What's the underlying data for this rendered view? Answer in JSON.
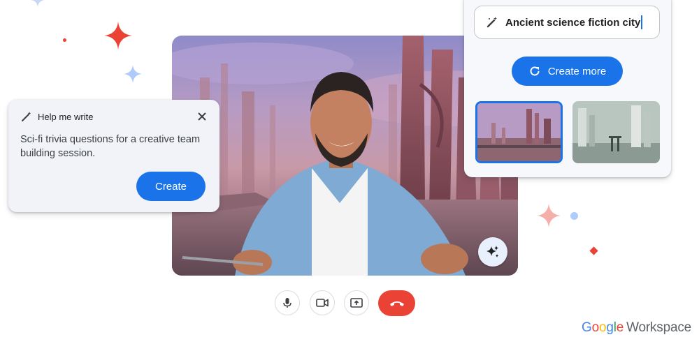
{
  "help_me_write": {
    "title": "Help me write",
    "prompt": "Sci-fi trivia questions for a creative team building session.",
    "create_label": "Create",
    "icons": {
      "title": "magic-pen-icon",
      "close": "close-icon"
    }
  },
  "background_panel": {
    "prompt_value": "Ancient science fiction city",
    "create_more_label": "Create more",
    "thumbnails": [
      {
        "name": "generated-background-1",
        "selected": true
      },
      {
        "name": "generated-background-2",
        "selected": false
      }
    ],
    "icons": {
      "input": "magic-brush-icon",
      "create_more": "refresh-icon"
    }
  },
  "call_controls": [
    {
      "name": "microphone",
      "icon": "microphone-icon"
    },
    {
      "name": "camera",
      "icon": "camera-icon"
    },
    {
      "name": "present",
      "icon": "present-screen-icon"
    },
    {
      "name": "end-call",
      "icon": "phone-hangup-icon"
    }
  ],
  "effects_button_icon": "sparkle-icon",
  "brand": {
    "google": "Google",
    "product": "Workspace"
  },
  "colors": {
    "primary_blue": "#1a73e8",
    "end_call_red": "#ea4335",
    "sparkle_red": "#ea4335",
    "sparkle_light_blue": "#aecbfa",
    "sparkle_pink": "#f6aea9"
  }
}
